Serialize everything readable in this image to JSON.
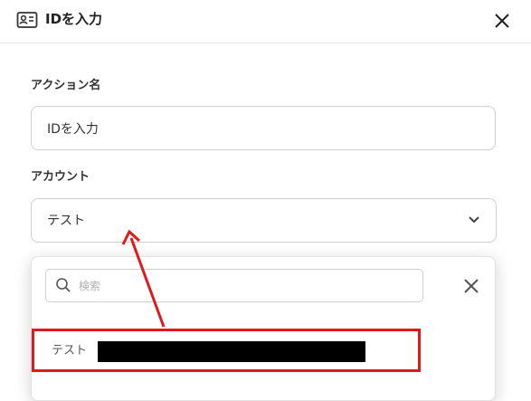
{
  "header": {
    "title": "IDを入力",
    "icon": "id-card-icon",
    "close_icon": "close-icon"
  },
  "form": {
    "action_name": {
      "label": "アクション名",
      "value": "IDを入力"
    },
    "account": {
      "label": "アカウント",
      "selected": "テスト",
      "chevron_icon": "chevron-down-icon"
    }
  },
  "dropdown": {
    "search_placeholder": "検索",
    "search_icon": "search-icon",
    "close_icon": "close-icon",
    "options": [
      {
        "label": "テスト",
        "redacted": true
      }
    ]
  },
  "annotation": {
    "color": "#e0191b"
  }
}
